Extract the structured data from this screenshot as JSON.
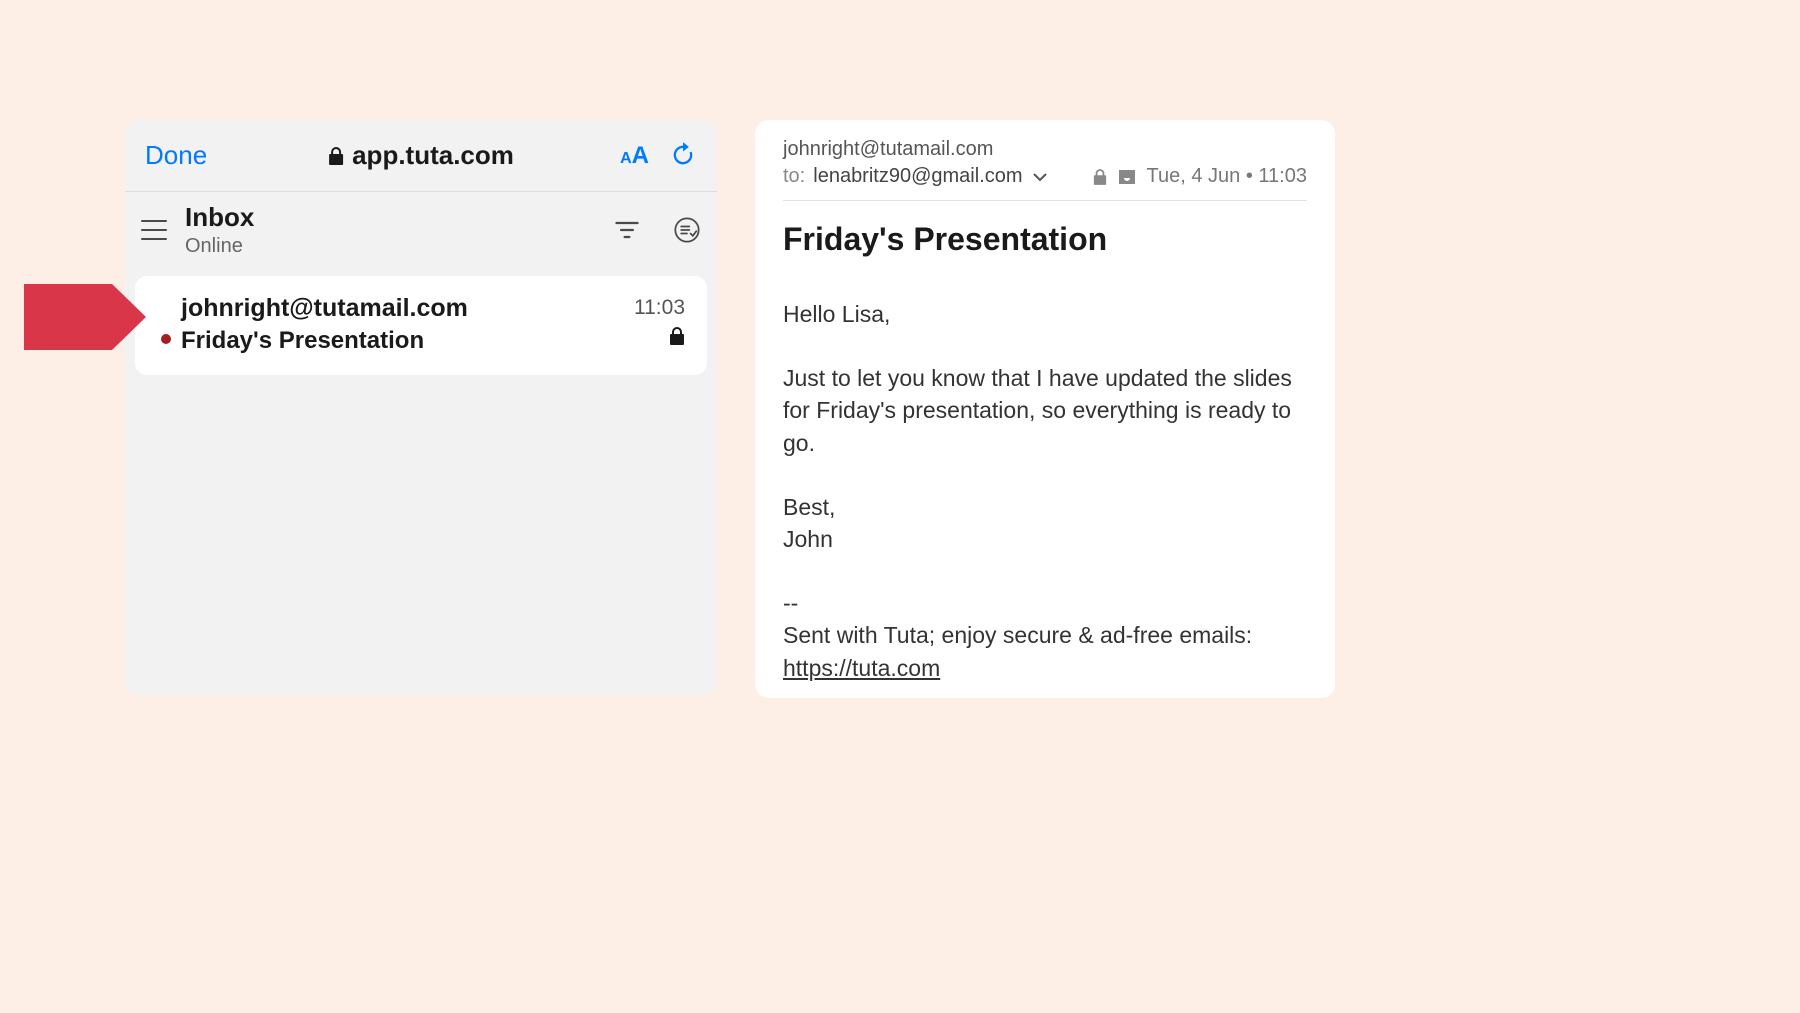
{
  "colors": {
    "accent_blue": "#007aff",
    "pointer_red": "#d9364a",
    "unread_dot": "#a41e22"
  },
  "browser": {
    "done_label": "Done",
    "url": "app.tuta.com"
  },
  "inbox": {
    "title": "Inbox",
    "status": "Online",
    "items": [
      {
        "sender": "johnright@tutamail.com",
        "subject": "Friday's Presentation",
        "time": "11:03",
        "unread": true,
        "encrypted": true
      }
    ]
  },
  "detail": {
    "from": "johnright@tutamail.com",
    "to_label": "to:",
    "to": "lenabritz90@gmail.com",
    "date": "Tue, 4 Jun • 11:03",
    "subject": "Friday's Presentation",
    "body": {
      "greeting": "Hello Lisa,",
      "para1": "Just to let you know that I have updated the slides for Friday's presentation, so everything is ready to go.",
      "signoff1": "Best,",
      "signoff2": "John",
      "sig_sep": "--",
      "sig_text": "Sent with Tuta; enjoy secure & ad-free emails:",
      "sig_link": "https://tuta.com"
    }
  }
}
